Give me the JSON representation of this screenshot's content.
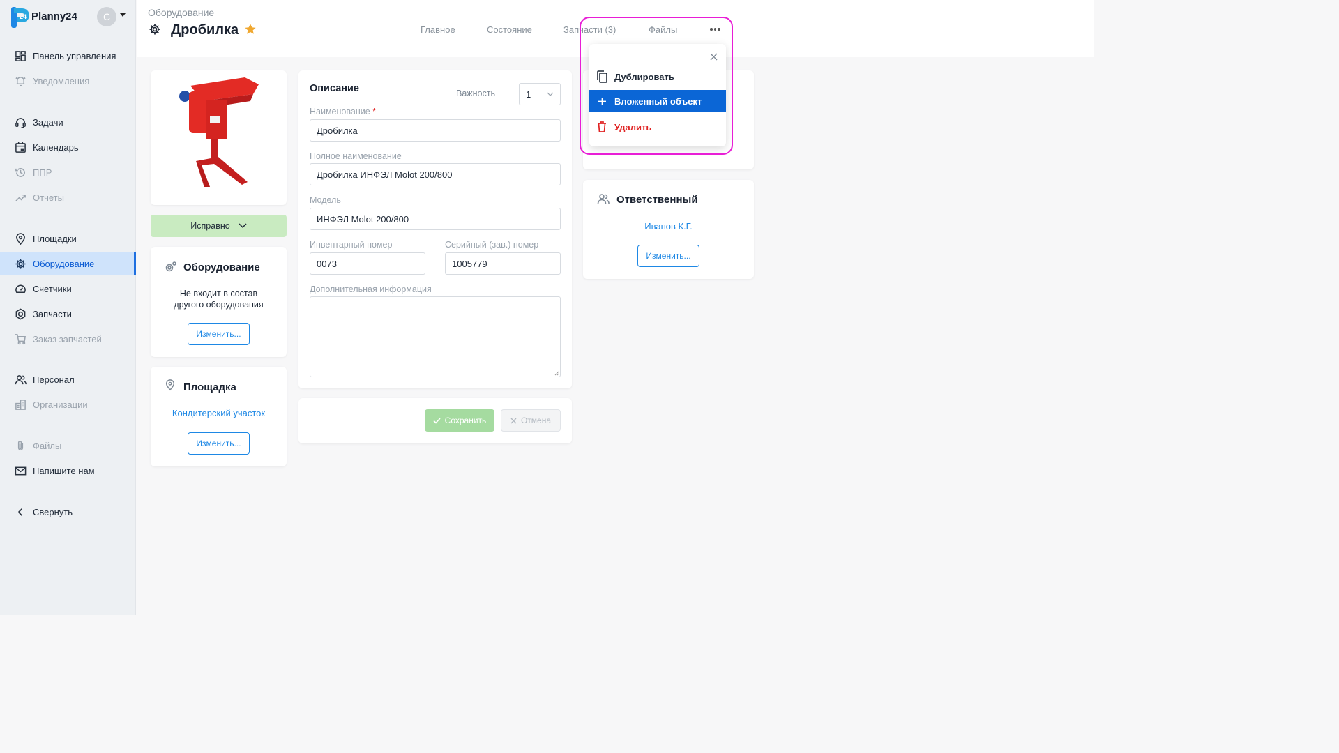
{
  "app": {
    "brand": "Planny24",
    "user_initial": "С"
  },
  "sidebar": {
    "items": [
      {
        "label": "Панель управления",
        "icon": "dashboard-icon"
      },
      {
        "label": "Уведомления",
        "icon": "bell-icon"
      },
      {
        "label": "Задачи",
        "icon": "headset-icon"
      },
      {
        "label": "Календарь",
        "icon": "calendar-icon"
      },
      {
        "label": "ППР",
        "icon": "history-icon"
      },
      {
        "label": "Отчеты",
        "icon": "trend-icon"
      },
      {
        "label": "Площадки",
        "icon": "pin-icon"
      },
      {
        "label": "Оборудование",
        "icon": "gear-icon"
      },
      {
        "label": "Счетчики",
        "icon": "gauge-icon"
      },
      {
        "label": "Запчасти",
        "icon": "hex-nut-icon"
      },
      {
        "label": "Заказ запчастей",
        "icon": "cart-icon"
      },
      {
        "label": "Персонал",
        "icon": "people-icon"
      },
      {
        "label": "Организации",
        "icon": "building-icon"
      },
      {
        "label": "Файлы",
        "icon": "paperclip-icon"
      },
      {
        "label": "Напишите нам",
        "icon": "mail-icon"
      },
      {
        "label": "Свернуть",
        "icon": "chevron-left-icon"
      }
    ]
  },
  "header": {
    "breadcrumb": "Оборудование",
    "title": "Дробилка",
    "tabs": [
      "Главное",
      "Состояние",
      "Запчасти (3)",
      "Файлы"
    ]
  },
  "status": {
    "label": "Исправно"
  },
  "equipment_card": {
    "title": "Оборудование",
    "text_line1": "Не входит в состав",
    "text_line2": "другого оборудования",
    "button": "Изменить..."
  },
  "site_card": {
    "title": "Площадка",
    "link": "Кондитерский участок",
    "button": "Изменить..."
  },
  "description": {
    "title": "Описание",
    "importance_label": "Важность",
    "importance_value": "1",
    "name_label": "Наименование",
    "name_required": "*",
    "name_value": "Дробилка",
    "full_name_label": "Полное наименование",
    "full_name_value": "Дробилка ИНФЭЛ Molot 200/800",
    "model_label": "Модель",
    "model_value": "ИНФЭЛ Molot 200/800",
    "inventory_label": "Инвентарный номер",
    "inventory_value": "0073",
    "serial_label": "Серийный (зав.) номер",
    "serial_value": "1005779",
    "extra_label": "Дополнительная информация",
    "extra_value": ""
  },
  "actions": {
    "save": "Сохранить",
    "cancel": "Отмена"
  },
  "responsible": {
    "title": "Ответственный",
    "person": "Иванов К.Г.",
    "button": "Изменить..."
  },
  "menu": {
    "items": [
      {
        "label": "Дублировать"
      },
      {
        "label": "Вложенный объект"
      },
      {
        "label": "Удалить"
      }
    ]
  },
  "colors": {
    "accent": "#1e6fe0",
    "status_bg": "#c9ebc1",
    "danger": "#e02424",
    "highlight": "#e81ed6",
    "star": "#f0a830"
  }
}
